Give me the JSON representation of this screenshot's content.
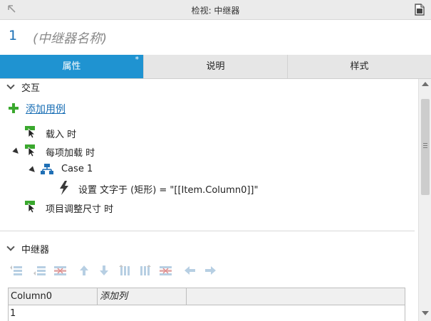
{
  "titlebar": {
    "title": "检视: 中继器",
    "collapse_icon": "collapse-arrow-icon",
    "page_icon": "page-icon"
  },
  "widget": {
    "index": "1",
    "name": "(中继器名称)"
  },
  "tabs": [
    {
      "label": "属性",
      "active": true,
      "marker": "*"
    },
    {
      "label": "说明",
      "active": false
    },
    {
      "label": "样式",
      "active": false
    }
  ],
  "interactions": {
    "section_label": "交互",
    "add_case_label": "添加用例",
    "events": [
      {
        "label": "载入 时"
      },
      {
        "label": "每项加载 时"
      },
      {
        "label": "项目调整尺寸 时"
      }
    ],
    "case_label": "Case 1",
    "action": {
      "verb": "设置",
      "detail": "文字于 (矩形) = \"[[Item.Column0]]\""
    }
  },
  "repeater": {
    "section_label": "中继器",
    "toolbar_icons": [
      "insert-row-above-icon",
      "insert-row-below-icon",
      "delete-row-icon",
      "move-up-icon",
      "move-down-icon",
      "insert-column-left-icon",
      "insert-column-right-icon",
      "delete-column-icon",
      "move-left-icon",
      "move-right-icon"
    ],
    "columns": [
      "Column0",
      "添加列"
    ],
    "rows": [
      [
        "1"
      ]
    ]
  },
  "colors": {
    "accent": "#1f93d1",
    "link": "#1a6fb5",
    "add_green": "#3aa82e",
    "action_green": "#2a8b19"
  }
}
